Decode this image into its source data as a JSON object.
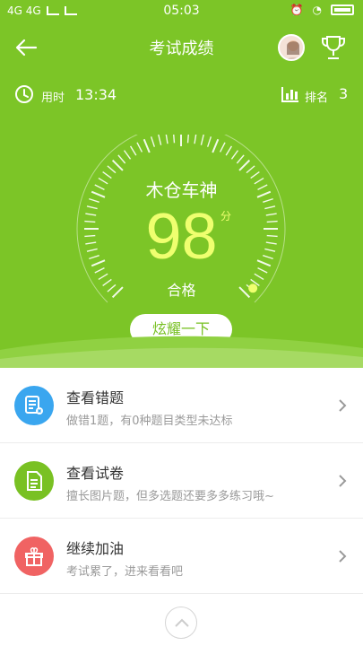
{
  "status_bar": {
    "left": "4G 4G",
    "time": "05:03"
  },
  "header": {
    "title": "考试成绩"
  },
  "metrics": {
    "used_label": "用时",
    "used_value": "13:34",
    "rank_label": "排名",
    "rank_value": "3"
  },
  "result": {
    "name": "木仓车神",
    "score": "98",
    "unit": "分",
    "status": "合格",
    "share_label": "炫耀一下"
  },
  "actions": [
    {
      "title": "查看错题",
      "subtitle": "做错1题，有0种题目类型未达标",
      "icon": "wrong-question-icon",
      "color": "#3aa6ef"
    },
    {
      "title": "查看试卷",
      "subtitle": "擅长图片题，但多选题还要多多练习哦~",
      "icon": "paper-icon",
      "color": "#79c123"
    },
    {
      "title": "继续加油",
      "subtitle": "考试累了，进来看看吧",
      "icon": "gift-icon",
      "color": "#f06363"
    }
  ],
  "colors": {
    "primary": "#7cc527",
    "accent_score": "#efff6f"
  }
}
